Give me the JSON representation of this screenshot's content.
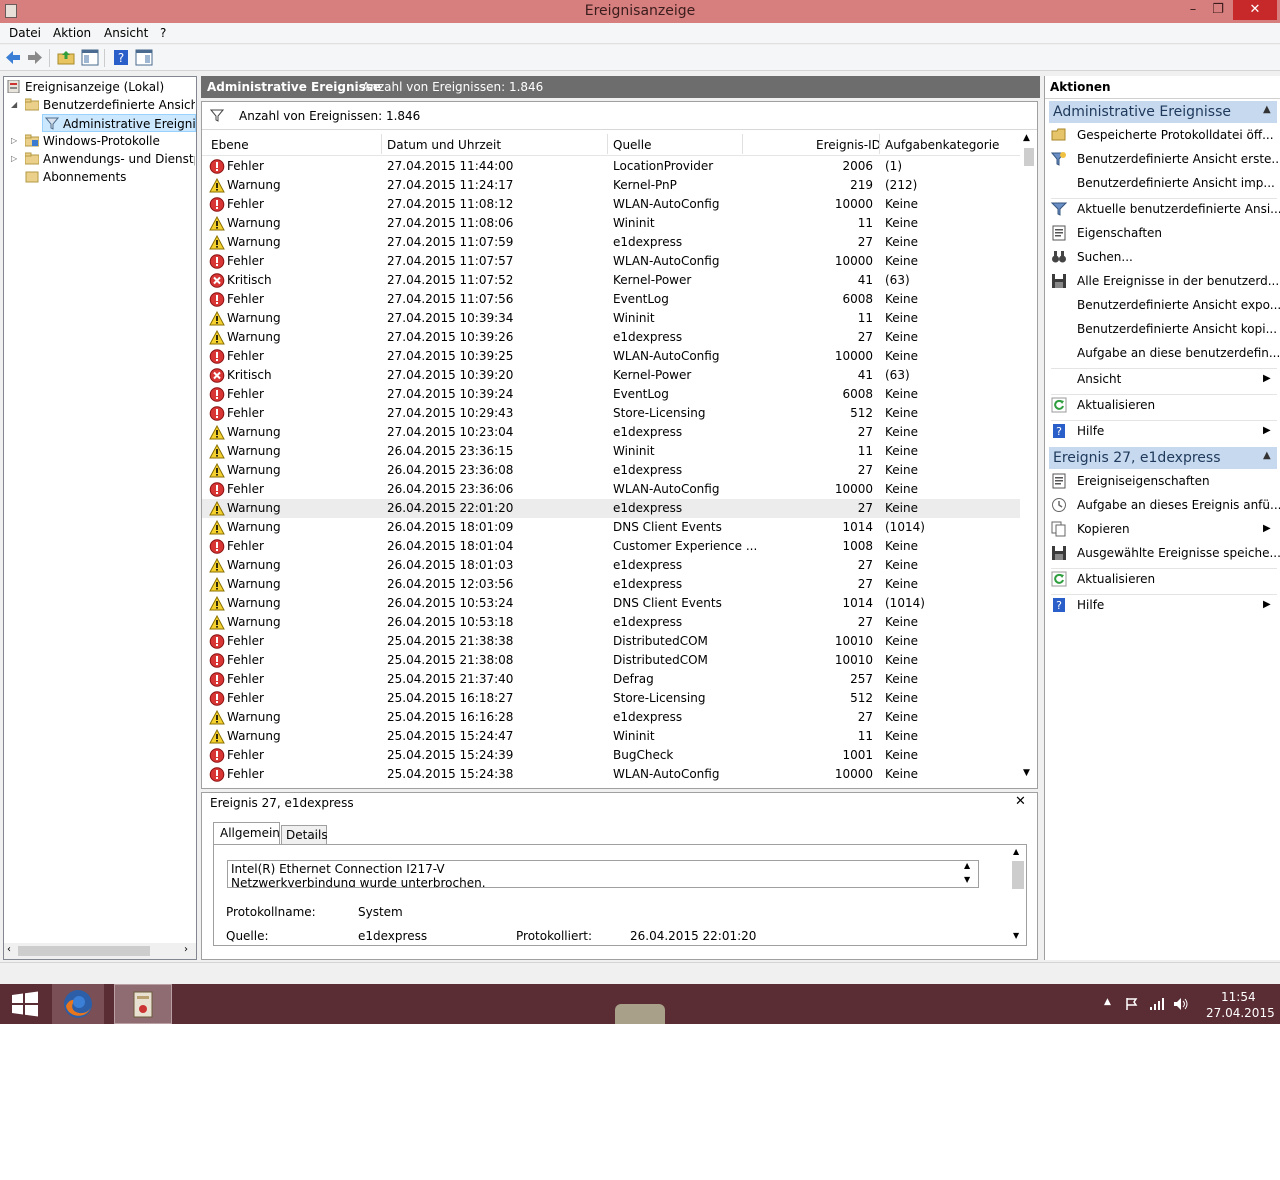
{
  "window": {
    "title": "Ereignisanzeige",
    "min_label": "–",
    "max_label": "❐",
    "close_label": "✕"
  },
  "menu": [
    "Datei",
    "Aktion",
    "Ansicht",
    "?"
  ],
  "tree": {
    "root": "Ereignisanzeige (Lokal)",
    "custom_views": "Benutzerdefinierte Ansichten",
    "admin_events": "Administrative Ereignisse",
    "windows_logs": "Windows-Protokolle",
    "app_service_logs": "Anwendungs- und Dienstprotokolle",
    "subscriptions": "Abonnements"
  },
  "center": {
    "header_title": "Administrative Ereignisse",
    "header_count": "Anzahl von Ereignissen: 1.846",
    "filter_text": "Anzahl von Ereignissen: 1.846",
    "columns": {
      "level": "Ebene",
      "datetime": "Datum und Uhrzeit",
      "source": "Quelle",
      "event_id": "Ereignis-ID",
      "category": "Aufgabenkategorie"
    }
  },
  "rows": [
    {
      "level": "Fehler",
      "type": "error",
      "date": "27.04.2015 11:44:00",
      "source": "LocationProvider",
      "id": "2006",
      "cat": "(1)"
    },
    {
      "level": "Warnung",
      "type": "warning",
      "date": "27.04.2015 11:24:17",
      "source": "Kernel-PnP",
      "id": "219",
      "cat": "(212)"
    },
    {
      "level": "Fehler",
      "type": "error",
      "date": "27.04.2015 11:08:12",
      "source": "WLAN-AutoConfig",
      "id": "10000",
      "cat": "Keine"
    },
    {
      "level": "Warnung",
      "type": "warning",
      "date": "27.04.2015 11:08:06",
      "source": "Wininit",
      "id": "11",
      "cat": "Keine"
    },
    {
      "level": "Warnung",
      "type": "warning",
      "date": "27.04.2015 11:07:59",
      "source": "e1dexpress",
      "id": "27",
      "cat": "Keine"
    },
    {
      "level": "Fehler",
      "type": "error",
      "date": "27.04.2015 11:07:57",
      "source": "WLAN-AutoConfig",
      "id": "10000",
      "cat": "Keine"
    },
    {
      "level": "Kritisch",
      "type": "critical",
      "date": "27.04.2015 11:07:52",
      "source": "Kernel-Power",
      "id": "41",
      "cat": "(63)"
    },
    {
      "level": "Fehler",
      "type": "error",
      "date": "27.04.2015 11:07:56",
      "source": "EventLog",
      "id": "6008",
      "cat": "Keine"
    },
    {
      "level": "Warnung",
      "type": "warning",
      "date": "27.04.2015 10:39:34",
      "source": "Wininit",
      "id": "11",
      "cat": "Keine"
    },
    {
      "level": "Warnung",
      "type": "warning",
      "date": "27.04.2015 10:39:26",
      "source": "e1dexpress",
      "id": "27",
      "cat": "Keine"
    },
    {
      "level": "Fehler",
      "type": "error",
      "date": "27.04.2015 10:39:25",
      "source": "WLAN-AutoConfig",
      "id": "10000",
      "cat": "Keine"
    },
    {
      "level": "Kritisch",
      "type": "critical",
      "date": "27.04.2015 10:39:20",
      "source": "Kernel-Power",
      "id": "41",
      "cat": "(63)"
    },
    {
      "level": "Fehler",
      "type": "error",
      "date": "27.04.2015 10:39:24",
      "source": "EventLog",
      "id": "6008",
      "cat": "Keine"
    },
    {
      "level": "Fehler",
      "type": "error",
      "date": "27.04.2015 10:29:43",
      "source": "Store-Licensing",
      "id": "512",
      "cat": "Keine"
    },
    {
      "level": "Warnung",
      "type": "warning",
      "date": "27.04.2015 10:23:04",
      "source": "e1dexpress",
      "id": "27",
      "cat": "Keine"
    },
    {
      "level": "Warnung",
      "type": "warning",
      "date": "26.04.2015 23:36:15",
      "source": "Wininit",
      "id": "11",
      "cat": "Keine"
    },
    {
      "level": "Warnung",
      "type": "warning",
      "date": "26.04.2015 23:36:08",
      "source": "e1dexpress",
      "id": "27",
      "cat": "Keine"
    },
    {
      "level": "Fehler",
      "type": "error",
      "date": "26.04.2015 23:36:06",
      "source": "WLAN-AutoConfig",
      "id": "10000",
      "cat": "Keine"
    },
    {
      "level": "Warnung",
      "type": "warning",
      "date": "26.04.2015 22:01:20",
      "source": "e1dexpress",
      "id": "27",
      "cat": "Keine",
      "selected": true
    },
    {
      "level": "Warnung",
      "type": "warning",
      "date": "26.04.2015 18:01:09",
      "source": "DNS Client Events",
      "id": "1014",
      "cat": "(1014)"
    },
    {
      "level": "Fehler",
      "type": "error",
      "date": "26.04.2015 18:01:04",
      "source": "Customer Experience ...",
      "id": "1008",
      "cat": "Keine"
    },
    {
      "level": "Warnung",
      "type": "warning",
      "date": "26.04.2015 18:01:03",
      "source": "e1dexpress",
      "id": "27",
      "cat": "Keine"
    },
    {
      "level": "Warnung",
      "type": "warning",
      "date": "26.04.2015 12:03:56",
      "source": "e1dexpress",
      "id": "27",
      "cat": "Keine"
    },
    {
      "level": "Warnung",
      "type": "warning",
      "date": "26.04.2015 10:53:24",
      "source": "DNS Client Events",
      "id": "1014",
      "cat": "(1014)"
    },
    {
      "level": "Warnung",
      "type": "warning",
      "date": "26.04.2015 10:53:18",
      "source": "e1dexpress",
      "id": "27",
      "cat": "Keine"
    },
    {
      "level": "Fehler",
      "type": "error",
      "date": "25.04.2015 21:38:38",
      "source": "DistributedCOM",
      "id": "10010",
      "cat": "Keine"
    },
    {
      "level": "Fehler",
      "type": "error",
      "date": "25.04.2015 21:38:08",
      "source": "DistributedCOM",
      "id": "10010",
      "cat": "Keine"
    },
    {
      "level": "Fehler",
      "type": "error",
      "date": "25.04.2015 21:37:40",
      "source": "Defrag",
      "id": "257",
      "cat": "Keine"
    },
    {
      "level": "Fehler",
      "type": "error",
      "date": "25.04.2015 16:18:27",
      "source": "Store-Licensing",
      "id": "512",
      "cat": "Keine"
    },
    {
      "level": "Warnung",
      "type": "warning",
      "date": "25.04.2015 16:16:28",
      "source": "e1dexpress",
      "id": "27",
      "cat": "Keine"
    },
    {
      "level": "Warnung",
      "type": "warning",
      "date": "25.04.2015 15:24:47",
      "source": "Wininit",
      "id": "11",
      "cat": "Keine"
    },
    {
      "level": "Fehler",
      "type": "error",
      "date": "25.04.2015 15:24:39",
      "source": "BugCheck",
      "id": "1001",
      "cat": "Keine"
    },
    {
      "level": "Fehler",
      "type": "error",
      "date": "25.04.2015 15:24:38",
      "source": "WLAN-AutoConfig",
      "id": "10000",
      "cat": "Keine"
    }
  ],
  "detail": {
    "title": "Ereignis 27, e1dexpress",
    "close_label": "✕",
    "tab_general": "Allgemein",
    "tab_details": "Details",
    "message_line1": "Intel(R) Ethernet Connection I217-V",
    "message_line2": "Netzwerkverbindung wurde unterbrochen.",
    "log_name_label": "Protokollname:",
    "log_name_value": "System",
    "source_label": "Quelle:",
    "source_value": "e1dexpress",
    "logged_label": "Protokolliert:",
    "logged_value": "26.04.2015 22:01:20"
  },
  "actions": {
    "title": "Aktionen",
    "section1_title": "Administrative Ereignisse",
    "section1": [
      {
        "label": "Gespeicherte Protokolldatei öff...",
        "icon": "folder-open-icon"
      },
      {
        "label": "Benutzerdefinierte Ansicht erste...",
        "icon": "filter-create-icon"
      },
      {
        "label": "Benutzerdefinierte Ansicht imp...",
        "icon": ""
      },
      {
        "label": "Aktuelle benutzerdefinierte Ansi...",
        "icon": "filter-icon"
      },
      {
        "label": "Eigenschaften",
        "icon": "properties-icon"
      },
      {
        "label": "Suchen...",
        "icon": "binoculars-icon"
      },
      {
        "label": "Alle Ereignisse in der benutzerd...",
        "icon": "save-icon"
      },
      {
        "label": "Benutzerdefinierte Ansicht expo...",
        "icon": ""
      },
      {
        "label": "Benutzerdefinierte Ansicht kopi...",
        "icon": ""
      },
      {
        "label": "Aufgabe an diese benutzerdefin...",
        "icon": ""
      },
      {
        "label": "Ansicht",
        "icon": "",
        "submenu": true
      },
      {
        "label": "Aktualisieren",
        "icon": "refresh-icon"
      },
      {
        "label": "Hilfe",
        "icon": "help-icon",
        "submenu": true
      }
    ],
    "section2_title": "Ereignis 27, e1dexpress",
    "section2": [
      {
        "label": "Ereigniseigenschaften",
        "icon": "properties-icon"
      },
      {
        "label": "Aufgabe an dieses Ereignis anfü...",
        "icon": "task-icon"
      },
      {
        "label": "Kopieren",
        "icon": "copy-icon",
        "submenu": true
      },
      {
        "label": "Ausgewählte Ereignisse speiche...",
        "icon": "save-icon"
      },
      {
        "label": "Aktualisieren",
        "icon": "refresh-icon"
      },
      {
        "label": "Hilfe",
        "icon": "help-icon",
        "submenu": true
      }
    ]
  },
  "taskbar": {
    "time": "11:54",
    "date": "27.04.2015"
  },
  "colors": {
    "titlebar": "#d77f7f",
    "close": "#c7282a",
    "taskbar": "#5a2c33",
    "action_header": "#c7d9ee",
    "center_header": "#6d6d6d"
  }
}
